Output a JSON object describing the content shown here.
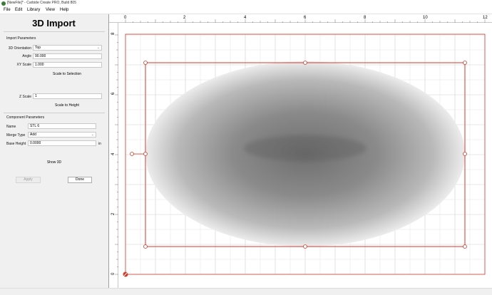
{
  "window": {
    "title": "[NewFile]* - Carbide Create PRO, Build 805"
  },
  "menu": [
    "File",
    "Edit",
    "Library",
    "View",
    "Help"
  ],
  "panel": {
    "title": "3D Import",
    "import_params": {
      "heading": "Import Parameters",
      "orientation_label": "3D Orientation",
      "orientation_value": "Top",
      "angle_label": "Angle",
      "angle_value": "90.000",
      "xy_scale_label": "XY Scale",
      "xy_scale_value": "1.000",
      "scale_to_selection": "Scale to Selection",
      "z_scale_label": "Z Scale",
      "z_scale_value": "1",
      "scale_to_height": "Scale to Height"
    },
    "component_params": {
      "heading": "Component Parameters",
      "name_label": "Name",
      "name_value": "STL 6",
      "merge_label": "Merge Type",
      "merge_value": "Add",
      "base_height_label": "Base Height",
      "base_height_value": "0.0000",
      "base_height_unit": "in"
    },
    "show_3d": "Show 3D",
    "apply": "Apply",
    "done": "Done"
  },
  "rulers": {
    "x_labels": [
      "0",
      "2",
      "4",
      "6",
      "8",
      "10",
      "12"
    ],
    "y_labels": [
      "0",
      "2",
      "4",
      "6",
      "8"
    ]
  },
  "colors": {
    "accent": "#d33a2c",
    "grid_minor": "#e6e6e6",
    "grid_major": "#cfcfcf"
  },
  "icons": {
    "app": "carbide-logo-icon",
    "origin": "origin-marker-icon",
    "dropdown": "chevron-down-icon"
  }
}
